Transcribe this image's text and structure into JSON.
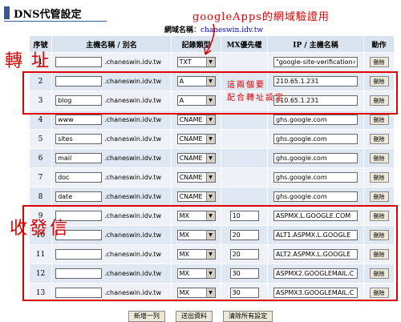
{
  "title": "DNS代管設定",
  "domain": {
    "label": "網域名稱",
    "value": "chaneswin.idv.tw"
  },
  "headers": [
    "序號",
    "主機名稱 / 別名",
    "記錄類型",
    "MX優先權",
    "IP / 主機名稱",
    "動作"
  ],
  "suffix": ".chaneswin.idv.tw",
  "delete_label": "刪除",
  "rows": [
    {
      "num": "1",
      "host": "",
      "type": "TXT",
      "mx": "",
      "target": "\"google-site-verification=iZ"
    },
    {
      "num": "2",
      "host": "",
      "type": "A",
      "mx": "",
      "target": "210.65.1.231"
    },
    {
      "num": "3",
      "host": "blog",
      "type": "A",
      "mx": "",
      "target": "210.65.1.231"
    },
    {
      "num": "4",
      "host": "www",
      "type": "CNAME",
      "mx": "",
      "target": "ghs.google.com"
    },
    {
      "num": "5",
      "host": "sites",
      "type": "CNAME",
      "mx": "",
      "target": "ghs.google.com"
    },
    {
      "num": "6",
      "host": "mail",
      "type": "CNAME",
      "mx": "",
      "target": "ghs.google.com"
    },
    {
      "num": "7",
      "host": "doc",
      "type": "CNAME",
      "mx": "",
      "target": "ghs.google.com"
    },
    {
      "num": "8",
      "host": "date",
      "type": "CNAME",
      "mx": "",
      "target": "ghs.google.com"
    },
    {
      "num": "9",
      "host": "",
      "type": "MX",
      "mx": "10",
      "target": "ASPMX.L.GOOGLE.COM"
    },
    {
      "num": "10",
      "host": "",
      "type": "MX",
      "mx": "20",
      "target": "ALT1.ASPMX.L.GOOGLE"
    },
    {
      "num": "11",
      "host": "",
      "type": "MX",
      "mx": "20",
      "target": "ALT2.ASPMX.L.GOOGLE"
    },
    {
      "num": "12",
      "host": "",
      "type": "MX",
      "mx": "30",
      "target": "ASPMX2.GOOGLEMAIL.C"
    },
    {
      "num": "13",
      "host": "",
      "type": "MX",
      "mx": "30",
      "target": "ASPMX3.GOOGLEMAIL.C"
    }
  ],
  "buttons": {
    "add": "新增一列",
    "submit": "送出資料",
    "clear": "清除所有設定"
  },
  "annotations": {
    "google_apps": "googleApps的網域驗證用",
    "forward": "轉 址",
    "pair_note_1": "這兩個要",
    "pair_note_2": "配合轉址設定",
    "mail": "收發信"
  },
  "colors": {
    "annotation": "#dd0000",
    "header_bg": "#d9e3ef",
    "accent": "#3a5a9a"
  }
}
